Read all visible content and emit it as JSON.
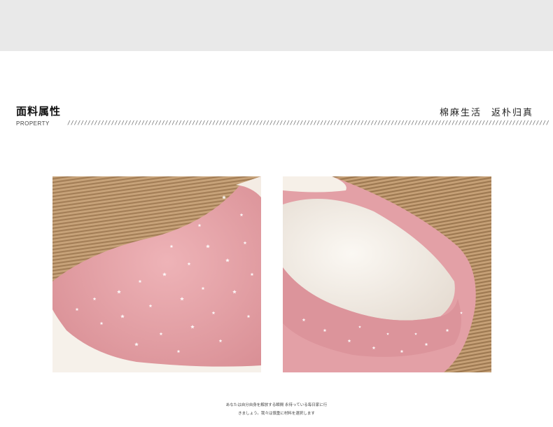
{
  "section": {
    "title": "面料属性",
    "subtitle": "PROPERTY",
    "slogan_left": "棉麻生活",
    "slogan_right": "返朴归真"
  },
  "colors": {
    "top_band": "#e9e9e9",
    "slipper_pink": "#e7a6ab",
    "fleece_white": "#f7f2ec",
    "mat_tan": "#b49068"
  },
  "images": [
    {
      "name": "slipper-toe-photo",
      "description_icon": "pink-star-slipper-toe"
    },
    {
      "name": "slipper-inner-photo",
      "description_icon": "pink-star-slipper-lining"
    }
  ],
  "caption": {
    "line1": "あなたは自分自身を解放する瞬間 永待っている毎日家に行",
    "line2": "きましょう。我々は慎重に材料を選択します"
  }
}
